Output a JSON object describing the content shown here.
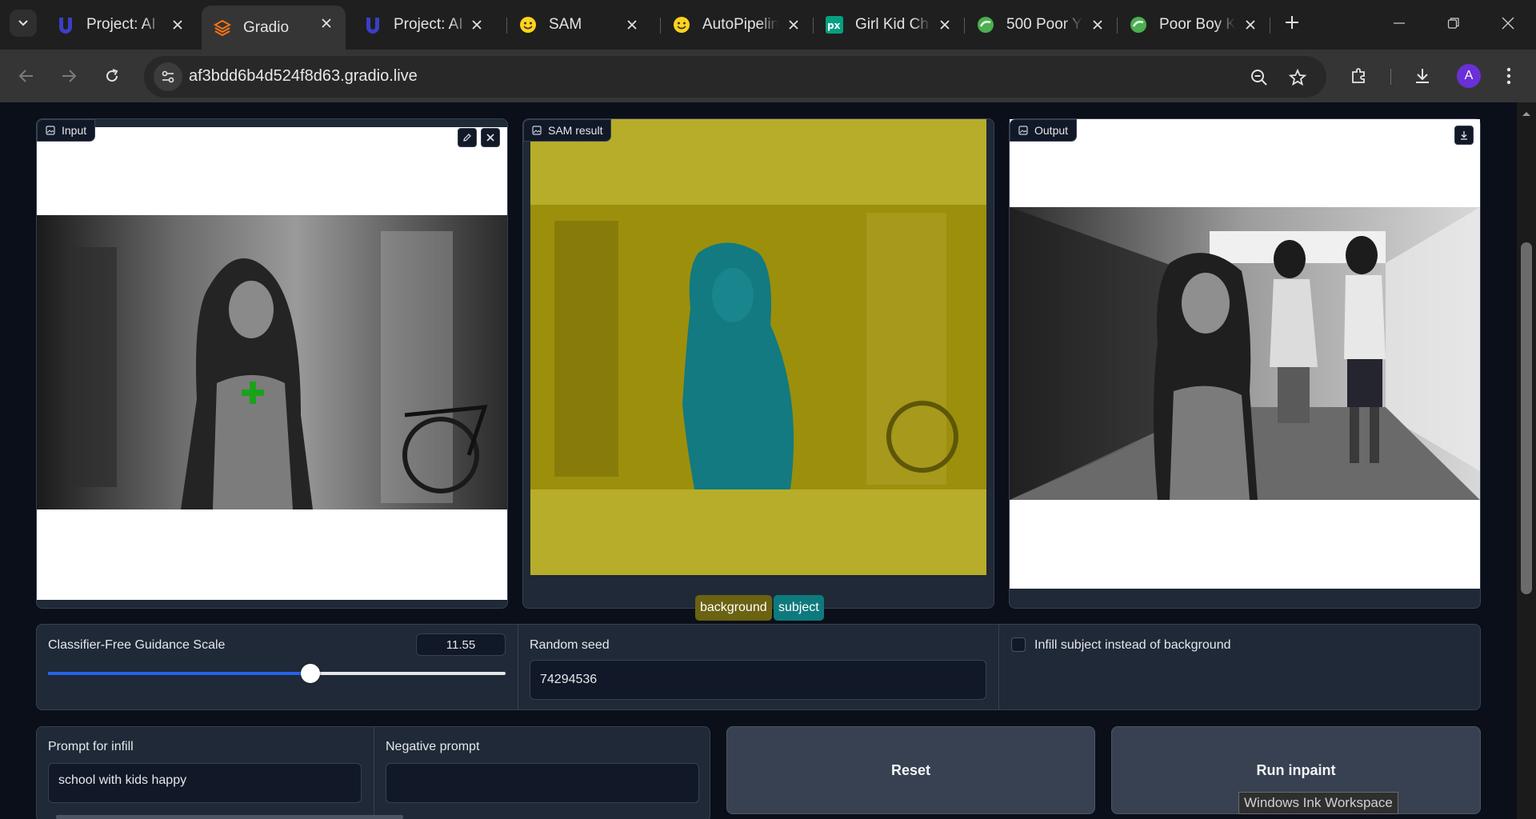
{
  "browser": {
    "tabs": [
      {
        "label": "Project: AI",
        "icon": "project-logo-icon",
        "active": false
      },
      {
        "label": "Gradio",
        "icon": "gradio-logo-icon",
        "active": true
      },
      {
        "label": "Project: AI",
        "icon": "project-logo-icon",
        "active": false
      },
      {
        "label": "SAM",
        "icon": "hugging-face-icon",
        "active": false
      },
      {
        "label": "AutoPipeline",
        "icon": "hugging-face-icon",
        "active": false
      },
      {
        "label": "Girl Kid Ch",
        "icon": "pexels-logo-icon",
        "active": false
      },
      {
        "label": "500 Poor Y",
        "icon": "green-globe-icon",
        "active": false
      },
      {
        "label": "Poor Boy K",
        "icon": "green-globe-icon",
        "active": false
      }
    ],
    "url": "af3bdd6b4d524f8d63.gradio.live",
    "profile_initial": "A"
  },
  "app": {
    "input_label": "Input",
    "sam_label": "SAM result",
    "output_label": "Output",
    "legend": [
      {
        "label": "background",
        "color": "#6b6212"
      },
      {
        "label": "subject",
        "color": "#0f7a7d"
      }
    ],
    "guidance_label": "Classifier-Free Guidance Scale",
    "guidance_value": "11.55",
    "guidance_fraction": 0.573,
    "seed_label": "Random seed",
    "seed_value": "74294536",
    "infill_checkbox_label": "Infill subject instead of background",
    "infill_checked": false,
    "prompt_label": "Prompt for infill",
    "prompt_value": "school with kids happy",
    "negative_label": "Negative prompt",
    "negative_value": "",
    "reset_label": "Reset",
    "run_label": "Run inpaint",
    "accent_color": "#2563eb"
  },
  "overlay": {
    "tooltip": "Windows Ink Workspace"
  }
}
